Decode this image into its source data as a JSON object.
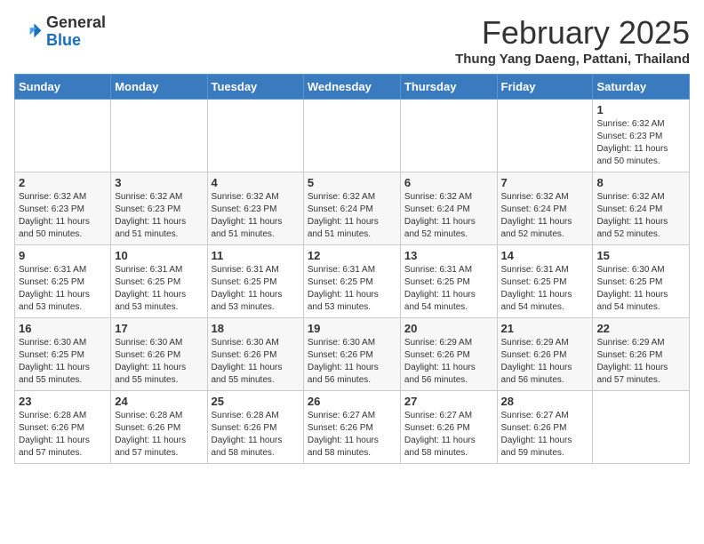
{
  "header": {
    "logo_general": "General",
    "logo_blue": "Blue",
    "month_year": "February 2025",
    "location": "Thung Yang Daeng, Pattani, Thailand"
  },
  "weekdays": [
    "Sunday",
    "Monday",
    "Tuesday",
    "Wednesday",
    "Thursday",
    "Friday",
    "Saturday"
  ],
  "weeks": [
    [
      {
        "day": "",
        "info": ""
      },
      {
        "day": "",
        "info": ""
      },
      {
        "day": "",
        "info": ""
      },
      {
        "day": "",
        "info": ""
      },
      {
        "day": "",
        "info": ""
      },
      {
        "day": "",
        "info": ""
      },
      {
        "day": "1",
        "info": "Sunrise: 6:32 AM\nSunset: 6:23 PM\nDaylight: 11 hours\nand 50 minutes."
      }
    ],
    [
      {
        "day": "2",
        "info": "Sunrise: 6:32 AM\nSunset: 6:23 PM\nDaylight: 11 hours\nand 50 minutes."
      },
      {
        "day": "3",
        "info": "Sunrise: 6:32 AM\nSunset: 6:23 PM\nDaylight: 11 hours\nand 51 minutes."
      },
      {
        "day": "4",
        "info": "Sunrise: 6:32 AM\nSunset: 6:23 PM\nDaylight: 11 hours\nand 51 minutes."
      },
      {
        "day": "5",
        "info": "Sunrise: 6:32 AM\nSunset: 6:24 PM\nDaylight: 11 hours\nand 51 minutes."
      },
      {
        "day": "6",
        "info": "Sunrise: 6:32 AM\nSunset: 6:24 PM\nDaylight: 11 hours\nand 52 minutes."
      },
      {
        "day": "7",
        "info": "Sunrise: 6:32 AM\nSunset: 6:24 PM\nDaylight: 11 hours\nand 52 minutes."
      },
      {
        "day": "8",
        "info": "Sunrise: 6:32 AM\nSunset: 6:24 PM\nDaylight: 11 hours\nand 52 minutes."
      }
    ],
    [
      {
        "day": "9",
        "info": "Sunrise: 6:31 AM\nSunset: 6:25 PM\nDaylight: 11 hours\nand 53 minutes."
      },
      {
        "day": "10",
        "info": "Sunrise: 6:31 AM\nSunset: 6:25 PM\nDaylight: 11 hours\nand 53 minutes."
      },
      {
        "day": "11",
        "info": "Sunrise: 6:31 AM\nSunset: 6:25 PM\nDaylight: 11 hours\nand 53 minutes."
      },
      {
        "day": "12",
        "info": "Sunrise: 6:31 AM\nSunset: 6:25 PM\nDaylight: 11 hours\nand 53 minutes."
      },
      {
        "day": "13",
        "info": "Sunrise: 6:31 AM\nSunset: 6:25 PM\nDaylight: 11 hours\nand 54 minutes."
      },
      {
        "day": "14",
        "info": "Sunrise: 6:31 AM\nSunset: 6:25 PM\nDaylight: 11 hours\nand 54 minutes."
      },
      {
        "day": "15",
        "info": "Sunrise: 6:30 AM\nSunset: 6:25 PM\nDaylight: 11 hours\nand 54 minutes."
      }
    ],
    [
      {
        "day": "16",
        "info": "Sunrise: 6:30 AM\nSunset: 6:25 PM\nDaylight: 11 hours\nand 55 minutes."
      },
      {
        "day": "17",
        "info": "Sunrise: 6:30 AM\nSunset: 6:26 PM\nDaylight: 11 hours\nand 55 minutes."
      },
      {
        "day": "18",
        "info": "Sunrise: 6:30 AM\nSunset: 6:26 PM\nDaylight: 11 hours\nand 55 minutes."
      },
      {
        "day": "19",
        "info": "Sunrise: 6:30 AM\nSunset: 6:26 PM\nDaylight: 11 hours\nand 56 minutes."
      },
      {
        "day": "20",
        "info": "Sunrise: 6:29 AM\nSunset: 6:26 PM\nDaylight: 11 hours\nand 56 minutes."
      },
      {
        "day": "21",
        "info": "Sunrise: 6:29 AM\nSunset: 6:26 PM\nDaylight: 11 hours\nand 56 minutes."
      },
      {
        "day": "22",
        "info": "Sunrise: 6:29 AM\nSunset: 6:26 PM\nDaylight: 11 hours\nand 57 minutes."
      }
    ],
    [
      {
        "day": "23",
        "info": "Sunrise: 6:28 AM\nSunset: 6:26 PM\nDaylight: 11 hours\nand 57 minutes."
      },
      {
        "day": "24",
        "info": "Sunrise: 6:28 AM\nSunset: 6:26 PM\nDaylight: 11 hours\nand 57 minutes."
      },
      {
        "day": "25",
        "info": "Sunrise: 6:28 AM\nSunset: 6:26 PM\nDaylight: 11 hours\nand 58 minutes."
      },
      {
        "day": "26",
        "info": "Sunrise: 6:27 AM\nSunset: 6:26 PM\nDaylight: 11 hours\nand 58 minutes."
      },
      {
        "day": "27",
        "info": "Sunrise: 6:27 AM\nSunset: 6:26 PM\nDaylight: 11 hours\nand 58 minutes."
      },
      {
        "day": "28",
        "info": "Sunrise: 6:27 AM\nSunset: 6:26 PM\nDaylight: 11 hours\nand 59 minutes."
      },
      {
        "day": "",
        "info": ""
      }
    ]
  ]
}
